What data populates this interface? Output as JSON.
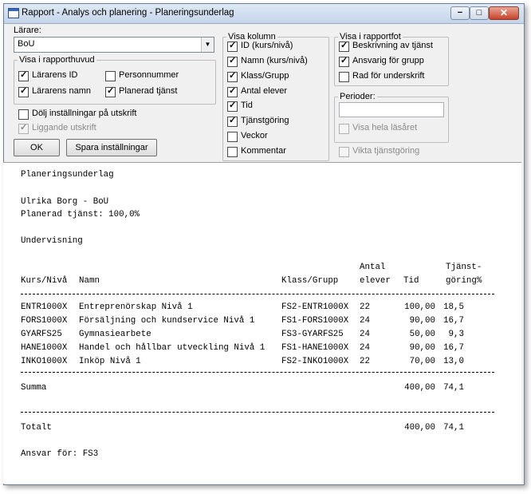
{
  "window": {
    "title": "Rapport - Analys och planering - Planeringsunderlag",
    "min_glyph": "−",
    "max_glyph": "□",
    "close_glyph": "✕"
  },
  "settings": {
    "teacher_label": "Lärare:",
    "teacher_value": "BoU",
    "header_group": {
      "legend": "Visa i rapporthuvud",
      "teacher_id": {
        "label": "Lärarens ID",
        "checked": true
      },
      "teacher_name": {
        "label": "Lärarens namn",
        "checked": true
      },
      "personnummer": {
        "label": "Personnummer",
        "checked": false
      },
      "planned": {
        "label": "Planerad tjänst",
        "checked": true
      }
    },
    "hide_settings": {
      "label": "Dölj inställningar på utskrift",
      "checked": false
    },
    "landscape": {
      "label": "Liggande utskrift",
      "checked": true,
      "disabled": true
    },
    "ok_label": "OK",
    "save_label": "Spara inställningar",
    "columns": {
      "legend": "Visa kolumn",
      "id": {
        "label": "ID (kurs/nivå)",
        "checked": true
      },
      "name": {
        "label": "Namn (kurs/nivå)",
        "checked": true
      },
      "class": {
        "label": "Klass/Grupp",
        "checked": true
      },
      "students": {
        "label": "Antal elever",
        "checked": true
      },
      "time": {
        "label": "Tid",
        "checked": true
      },
      "service": {
        "label": "Tjänstgöring",
        "checked": true
      },
      "weeks": {
        "label": "Veckor",
        "checked": false
      },
      "comment": {
        "label": "Kommentar",
        "checked": false
      }
    },
    "footer_group": {
      "legend": "Visa i rapportfot",
      "description": {
        "label": "Beskrivning av tjänst",
        "checked": true
      },
      "responsible": {
        "label": "Ansvarig för grupp",
        "checked": true
      },
      "signature": {
        "label": "Rad för underskrift",
        "checked": false
      }
    },
    "periods": {
      "legend": "Perioder:",
      "input_value": "",
      "whole_year": {
        "label": "Visa hela läsåret",
        "checked": false,
        "disabled": true
      }
    },
    "weighted": {
      "label": "Vikta tjänstgöring",
      "checked": false,
      "disabled": true
    }
  },
  "report": {
    "title": "Planeringsunderlag",
    "teacher_line": "Ulrika Borg - BoU",
    "planned_line": "Planerad tjänst: 100,0%",
    "section": "Undervisning",
    "headers": {
      "kurs": "Kurs/Nivå",
      "namn": "Namn",
      "klass": "Klass/Grupp",
      "antal_top": "Antal",
      "antal_bottom": "elever",
      "tid": "Tid",
      "tjanst_top": "Tjänst-",
      "tjanst_bottom": "göring%"
    },
    "rows": [
      {
        "kurs": "ENTR1000X",
        "namn": "Entreprenörskap Nivå 1",
        "klass": "FS2-ENTR1000X",
        "elever": "22",
        "tid": "100,00",
        "tjanst": "18,5"
      },
      {
        "kurs": "FORS1000X",
        "namn": "Försäljning och kundservice Nivå 1",
        "klass": "FS1-FORS1000X",
        "elever": "24",
        "tid": "90,00",
        "tjanst": "16,7"
      },
      {
        "kurs": "GYARFS25",
        "namn": "Gymnasiearbete",
        "klass": "FS3-GYARFS25",
        "elever": "24",
        "tid": "50,00",
        "tjanst": "9,3"
      },
      {
        "kurs": "HANE1000X",
        "namn": "Handel och hållbar utveckling Nivå 1",
        "klass": "FS1-HANE1000X",
        "elever": "24",
        "tid": "90,00",
        "tjanst": "16,7"
      },
      {
        "kurs": "INKO1000X",
        "namn": "Inköp Nivå 1",
        "klass": "FS2-INKO1000X",
        "elever": "22",
        "tid": "70,00",
        "tjanst": "13,0"
      }
    ],
    "summa": {
      "label": "Summa",
      "tid": "400,00",
      "tjanst": "74,1"
    },
    "totalt": {
      "label": "Totalt",
      "tid": "400,00",
      "tjanst": "74,1"
    },
    "responsible_line": "Ansvar för: FS3"
  }
}
